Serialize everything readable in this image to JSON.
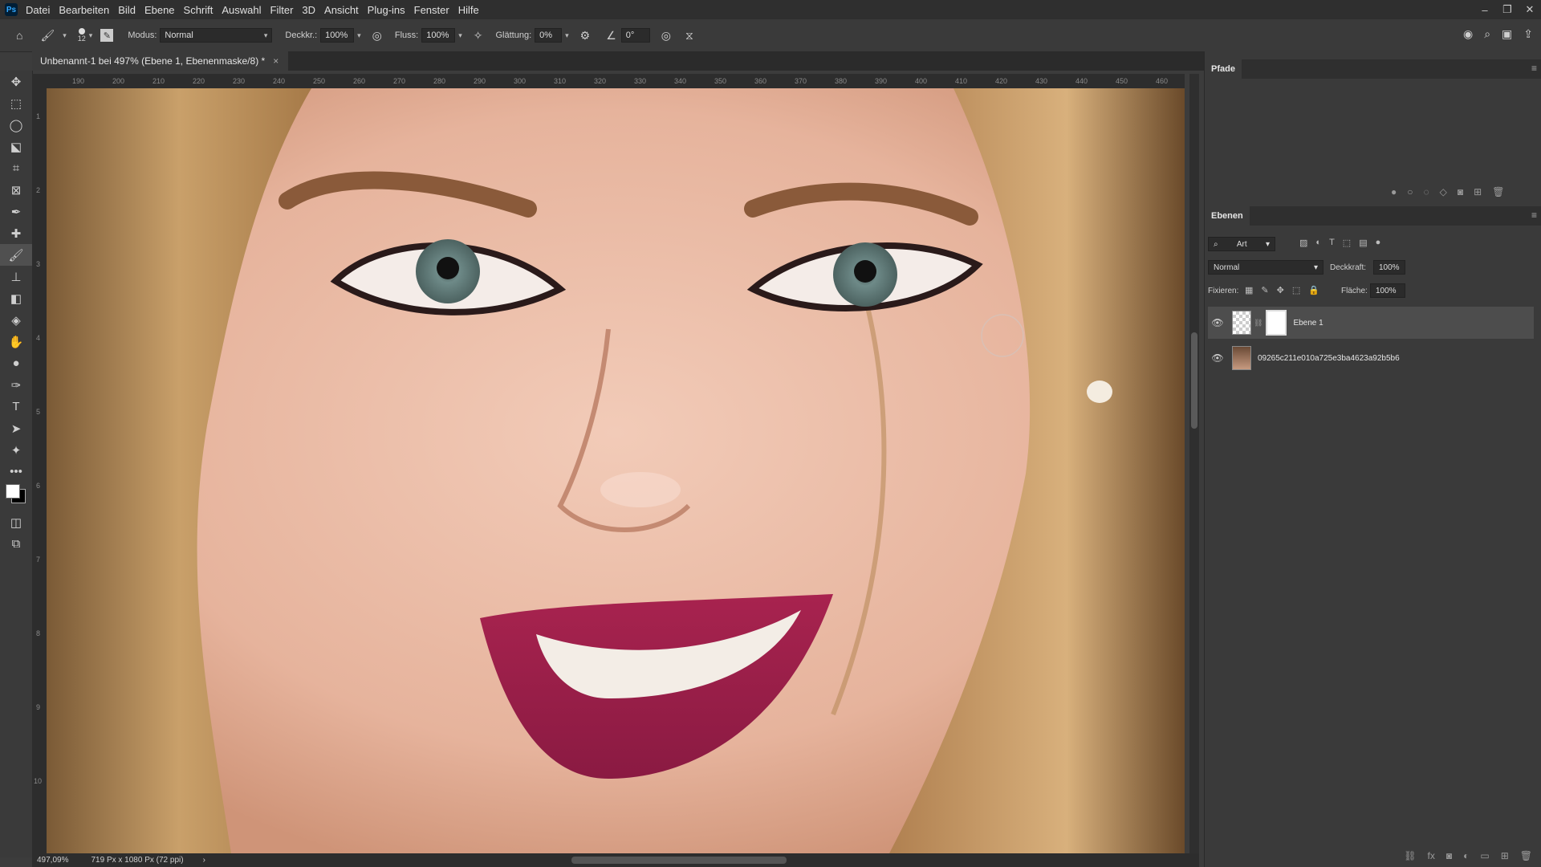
{
  "app": {
    "logo": "Ps"
  },
  "menu": [
    "Datei",
    "Bearbeiten",
    "Bild",
    "Ebene",
    "Schrift",
    "Auswahl",
    "Filter",
    "3D",
    "Ansicht",
    "Plug-ins",
    "Fenster",
    "Hilfe"
  ],
  "window_controls": {
    "minimize": "–",
    "restore": "❐",
    "close": "✕"
  },
  "options": {
    "brush_size": "12",
    "mode_label": "Modus:",
    "mode_value": "Normal",
    "opacity_label": "Deckkr.:",
    "opacity_value": "100%",
    "flow_label": "Fluss:",
    "flow_value": "100%",
    "smoothing_label": "Glättung:",
    "smoothing_value": "0%",
    "angle_value": "0°"
  },
  "document": {
    "tab_title": "Unbenannt-1 bei 497% (Ebene 1, Ebenenmaske/8) *",
    "close": "×"
  },
  "ruler_top": [
    "190",
    "200",
    "210",
    "220",
    "230",
    "240",
    "250",
    "260",
    "270",
    "280",
    "290",
    "300",
    "310",
    "320",
    "330",
    "340",
    "350",
    "360",
    "370",
    "380",
    "390",
    "400",
    "410",
    "420",
    "430",
    "440",
    "450",
    "460"
  ],
  "ruler_left": [
    "1",
    "2",
    "3",
    "4",
    "5",
    "6",
    "7",
    "8",
    "9",
    "10"
  ],
  "status": {
    "zoom": "497,09%",
    "info": "719 Px x 1080 Px (72 ppi)",
    "arrow": "›"
  },
  "paths_panel": {
    "title": "Pfade"
  },
  "layers_panel": {
    "title": "Ebenen",
    "filter_kind": "Art",
    "blend_mode": "Normal",
    "opacity_label": "Deckkraft:",
    "opacity_value": "100%",
    "lock_label": "Fixieren:",
    "fill_label": "Fläche:",
    "fill_value": "100%",
    "layers": [
      {
        "name": "Ebene 1",
        "selected": true
      },
      {
        "name": "09265c211e010a725e3ba4623a92b5b6",
        "selected": false
      }
    ]
  },
  "tools": [
    "move-icon",
    "marquee-icon",
    "lasso-icon",
    "object-select-icon",
    "crop-icon",
    "frame-icon",
    "eyedropper-icon",
    "healing-brush-icon",
    "brush-icon",
    "stamp-icon",
    "eraser-icon",
    "paint-bucket-icon",
    "dodge-icon",
    "smudge-icon",
    "pen-icon",
    "type-icon",
    "path-select-icon",
    "shape-icon",
    "more-tools-icon"
  ]
}
